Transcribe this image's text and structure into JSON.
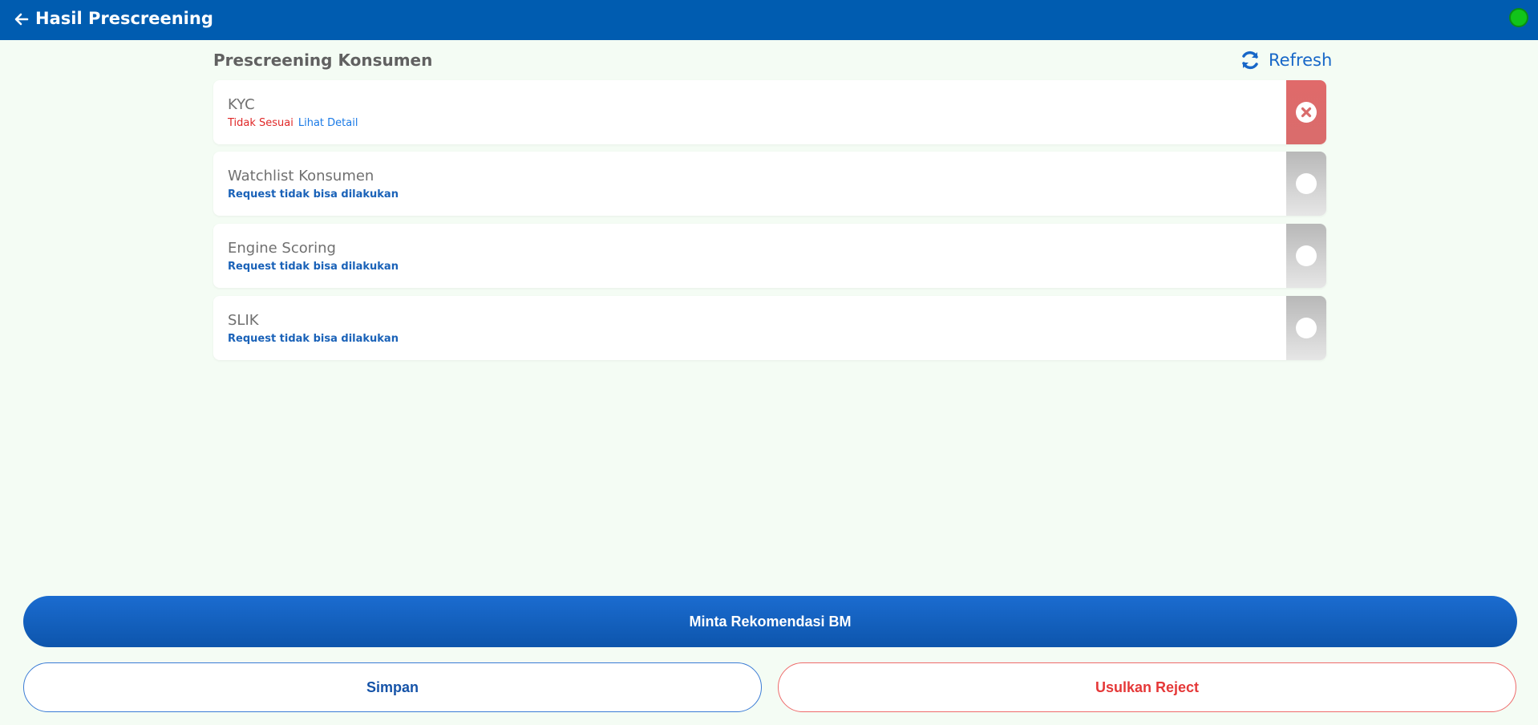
{
  "header": {
    "title": "Hasil Prescreening",
    "status_color": "#11c41a"
  },
  "section": {
    "title": "Prescreening Konsumen",
    "refresh_label": "Refresh"
  },
  "checks": [
    {
      "title": "KYC",
      "status": "Tidak Sesuai",
      "link": "Lihat Detail",
      "state": "failed",
      "icon": "close-circle-icon"
    },
    {
      "title": "Watchlist Konsumen",
      "status": "Request tidak bisa dilakukan",
      "state": "pending",
      "icon": "circle-icon"
    },
    {
      "title": "Engine Scoring",
      "status": "Request tidak bisa dilakukan",
      "state": "pending",
      "icon": "circle-icon"
    },
    {
      "title": "SLIK",
      "status": "Request tidak bisa dilakukan",
      "state": "pending",
      "icon": "circle-icon"
    }
  ],
  "actions": {
    "primary_label": "Minta Rekomendasi BM",
    "save_label": "Simpan",
    "reject_label": "Usulkan Reject"
  }
}
